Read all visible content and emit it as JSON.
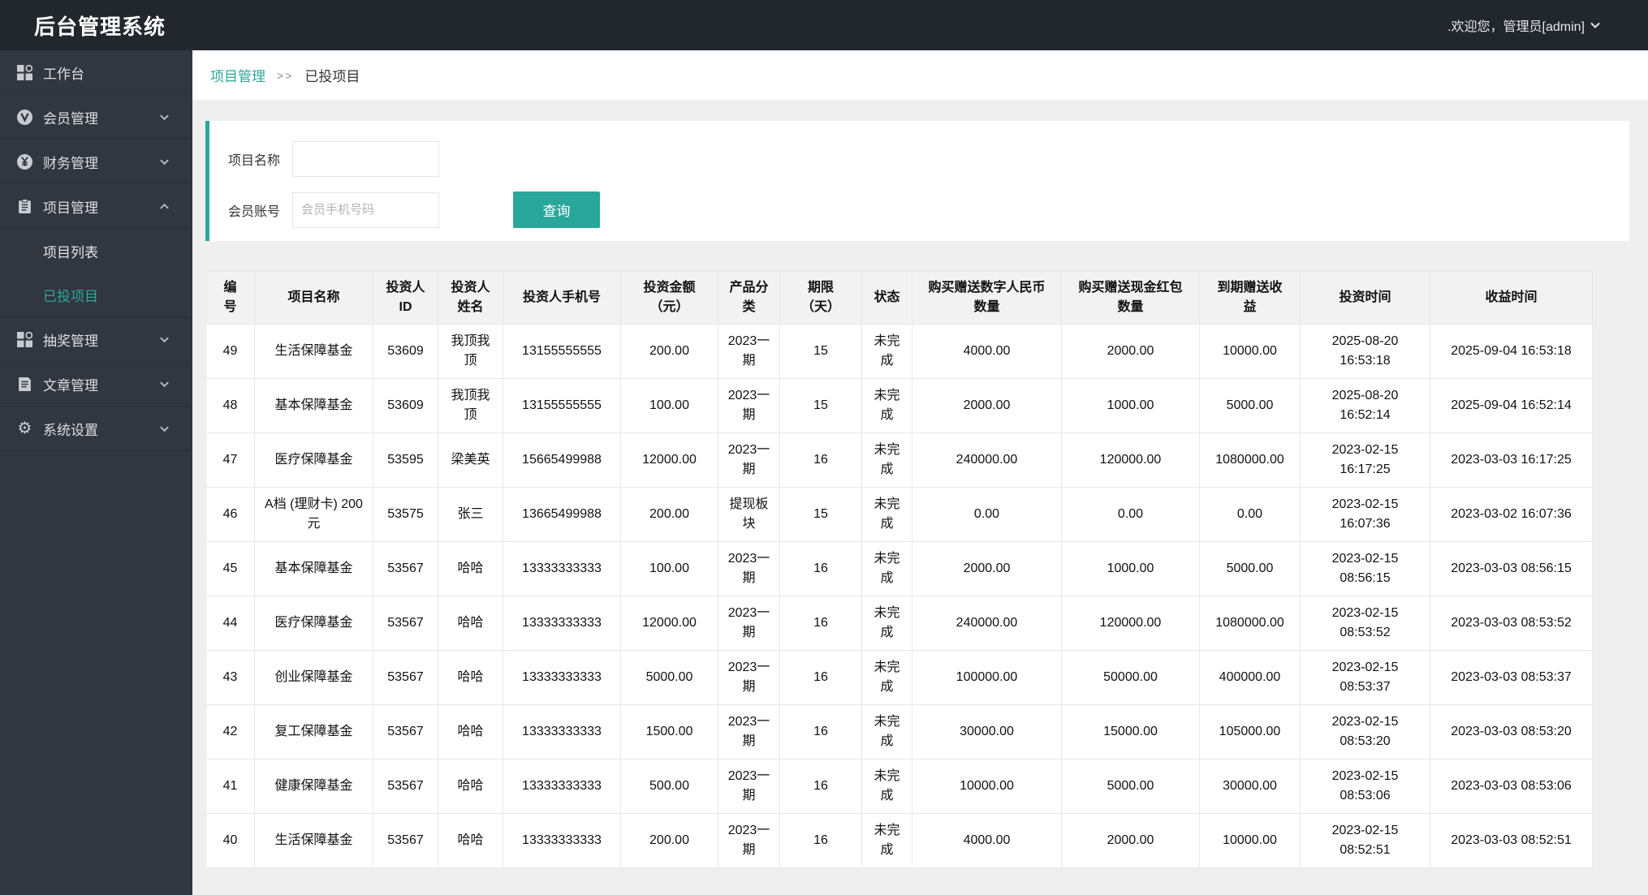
{
  "header": {
    "title": "后台管理系统",
    "welcome": ".欢迎您，管理员[admin]"
  },
  "sidebar": {
    "items": [
      {
        "label": "工作台",
        "icon": "grid-icon"
      },
      {
        "label": "会员管理",
        "icon": "member-circle-icon",
        "chevron": "down"
      },
      {
        "label": "财务管理",
        "icon": "finance-yen-icon",
        "chevron": "down"
      },
      {
        "label": "项目管理",
        "icon": "clipboard-icon",
        "chevron": "up",
        "expanded": true
      },
      {
        "label": "抽奖管理",
        "icon": "grid-icon",
        "chevron": "down"
      },
      {
        "label": "文章管理",
        "icon": "article-icon",
        "chevron": "down"
      },
      {
        "label": "系统设置",
        "icon": "gear-icon",
        "chevron": "down"
      }
    ],
    "submenu": [
      {
        "label": "项目列表",
        "active": false
      },
      {
        "label": "已投项目",
        "active": true
      }
    ]
  },
  "breadcrumb": {
    "parent": "项目管理",
    "separator": ">>",
    "current": "已投项目"
  },
  "filters": {
    "project_name_label": "项目名称",
    "member_account_label": "会员账号",
    "member_account_placeholder": "会员手机号码",
    "search_button": "查询"
  },
  "table": {
    "columns": [
      "编号",
      "项目名称",
      "投资人ID",
      "投资人姓名",
      "投资人手机号",
      "投资金额（元）",
      "产品分类",
      "期限（天）",
      "状态",
      "购买赠送数字人民币数量",
      "购买赠送现金红包数量",
      "到期赠送收益",
      "投资时间",
      "收益时间"
    ],
    "rows": [
      [
        "49",
        "生活保障基金",
        "53609",
        "我顶我顶",
        "13155555555",
        "200.00",
        "2023一期",
        "15",
        "未完成",
        "4000.00",
        "2000.00",
        "10000.00",
        "2025-08-20 16:53:18",
        "2025-09-04 16:53:18"
      ],
      [
        "48",
        "基本保障基金",
        "53609",
        "我顶我顶",
        "13155555555",
        "100.00",
        "2023一期",
        "15",
        "未完成",
        "2000.00",
        "1000.00",
        "5000.00",
        "2025-08-20 16:52:14",
        "2025-09-04 16:52:14"
      ],
      [
        "47",
        "医疗保障基金",
        "53595",
        "梁美英",
        "15665499988",
        "12000.00",
        "2023一期",
        "16",
        "未完成",
        "240000.00",
        "120000.00",
        "1080000.00",
        "2023-02-15 16:17:25",
        "2023-03-03 16:17:25"
      ],
      [
        "46",
        "A档 (理财卡) 200元",
        "53575",
        "张三",
        "13665499988",
        "200.00",
        "提现板块",
        "15",
        "未完成",
        "0.00",
        "0.00",
        "0.00",
        "2023-02-15 16:07:36",
        "2023-03-02 16:07:36"
      ],
      [
        "45",
        "基本保障基金",
        "53567",
        "哈哈",
        "13333333333",
        "100.00",
        "2023一期",
        "16",
        "未完成",
        "2000.00",
        "1000.00",
        "5000.00",
        "2023-02-15 08:56:15",
        "2023-03-03 08:56:15"
      ],
      [
        "44",
        "医疗保障基金",
        "53567",
        "哈哈",
        "13333333333",
        "12000.00",
        "2023一期",
        "16",
        "未完成",
        "240000.00",
        "120000.00",
        "1080000.00",
        "2023-02-15 08:53:52",
        "2023-03-03 08:53:52"
      ],
      [
        "43",
        "创业保障基金",
        "53567",
        "哈哈",
        "13333333333",
        "5000.00",
        "2023一期",
        "16",
        "未完成",
        "100000.00",
        "50000.00",
        "400000.00",
        "2023-02-15 08:53:37",
        "2023-03-03 08:53:37"
      ],
      [
        "42",
        "复工保障基金",
        "53567",
        "哈哈",
        "13333333333",
        "1500.00",
        "2023一期",
        "16",
        "未完成",
        "30000.00",
        "15000.00",
        "105000.00",
        "2023-02-15 08:53:20",
        "2023-03-03 08:53:20"
      ],
      [
        "41",
        "健康保障基金",
        "53567",
        "哈哈",
        "13333333333",
        "500.00",
        "2023一期",
        "16",
        "未完成",
        "10000.00",
        "5000.00",
        "30000.00",
        "2023-02-15 08:53:06",
        "2023-03-03 08:53:06"
      ],
      [
        "40",
        "生活保障基金",
        "53567",
        "哈哈",
        "13333333333",
        "200.00",
        "2023一期",
        "16",
        "未完成",
        "4000.00",
        "2000.00",
        "10000.00",
        "2023-02-15 08:52:51",
        "2023-03-03 08:52:51"
      ]
    ]
  },
  "colors": {
    "accent_teal": "#2aa79b",
    "header_bg": "#22262d",
    "sidebar_bg": "#32363f",
    "content_bg": "#efefef",
    "table_header_bg": "#f2f2f2",
    "table_border": "#e8e8e8"
  }
}
